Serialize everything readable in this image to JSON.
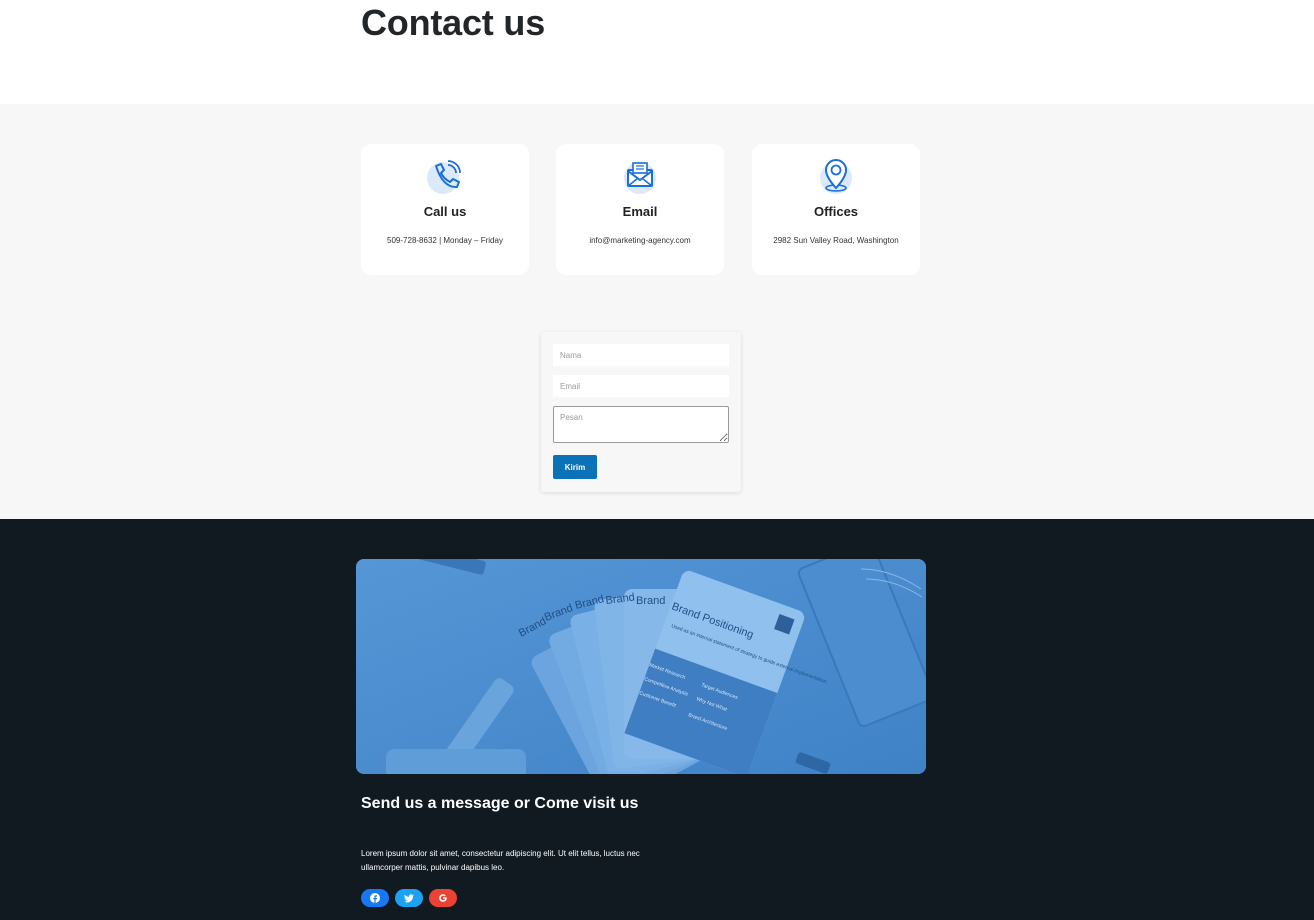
{
  "page": {
    "title": "Contact us"
  },
  "cards": [
    {
      "title": "Call us",
      "text": "509-728-8632 | Monday – Friday",
      "icon": "phone-icon"
    },
    {
      "title": "Email",
      "text": "info@marketing-agency.com",
      "icon": "envelope-icon"
    },
    {
      "title": "Offices",
      "text": "2982 Sun Valley Road, Washington",
      "icon": "location-pin-icon"
    }
  ],
  "form": {
    "name_placeholder": "Nama",
    "email_placeholder": "Email",
    "message_placeholder": "Pesan",
    "submit_label": "Kirim"
  },
  "footer": {
    "heading": "Send us a message or Come visit us",
    "text": "Lorem ipsum dolor sit amet, consectetur adipiscing elit. Ut elit tellus, luctus nec ullamcorper mattis, pulvinar dapibus leo.",
    "banner": {
      "card_titles": [
        "Brand",
        "Brand",
        "Brand",
        "Brand",
        "Brand",
        "Brand Positioning"
      ],
      "card_body": "Used as an internal statement of strategy to guide external implementation.",
      "card_list": [
        "Market Research",
        "Competitive Analysis",
        "Customer Benefit",
        "Target Audiences",
        "Why Not What",
        "Brand Architecture"
      ]
    },
    "social": [
      {
        "name": "facebook-icon",
        "color": "#1877f2"
      },
      {
        "name": "twitter-icon",
        "color": "#1da1f2"
      },
      {
        "name": "google-icon",
        "color": "#ea4335"
      }
    ]
  },
  "colors": {
    "accent": "#0b72b8",
    "footer_bg": "#111921",
    "band_bg": "#f7f7f7",
    "icon_blue": "#1b6fd8"
  }
}
